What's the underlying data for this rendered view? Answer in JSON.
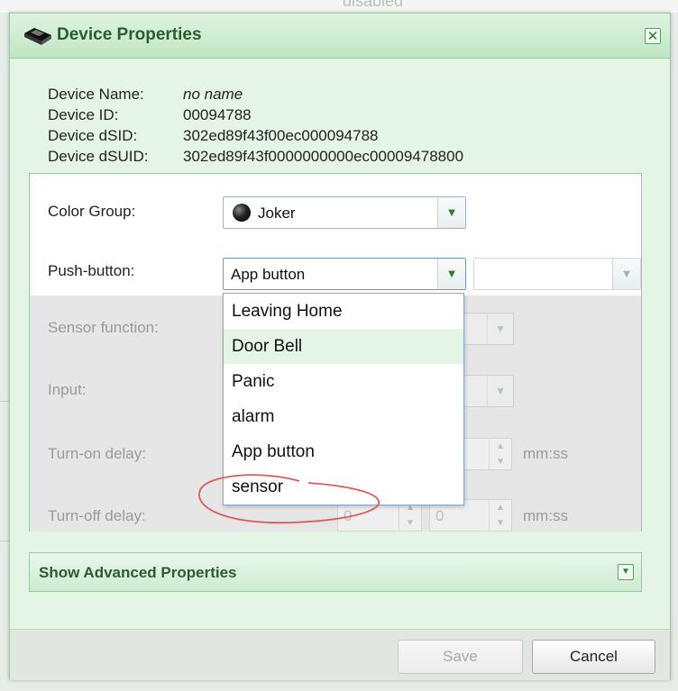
{
  "backdrop": {
    "ghost_text": "disabled"
  },
  "dialog": {
    "title": "Device Properties",
    "close_symbol": "✕"
  },
  "device_info": {
    "name_label": "Device Name:",
    "name_value": "no name",
    "id_label": "Device ID:",
    "id_value": "00094788",
    "dsid_label": "Device dSID:",
    "dsid_value": "302ed89f43f00ec000094788",
    "dsuid_label": "Device dSUID:",
    "dsuid_value": "302ed89f43f0000000000ec00009478800"
  },
  "form": {
    "color_group": {
      "label": "Color Group:",
      "value": "Joker"
    },
    "push_button": {
      "label": "Push-button:",
      "value": "App button",
      "secondary_value": ""
    },
    "sensor_function": {
      "label": "Sensor function:"
    },
    "input": {
      "label": "Input:"
    },
    "turn_on_delay": {
      "label": "Turn-on delay:",
      "unit": "mm:ss"
    },
    "turn_off_delay": {
      "label": "Turn-off delay:",
      "minutes": "0",
      "seconds": "0",
      "unit": "mm:ss"
    }
  },
  "dropdown": {
    "options": [
      "Leaving Home",
      "Door Bell",
      "Panic",
      "alarm",
      "App button",
      "sensor"
    ],
    "hovered": "Door Bell"
  },
  "advanced": {
    "label": "Show Advanced Properties"
  },
  "buttons": {
    "save": "Save",
    "cancel": "Cancel"
  },
  "colors": {
    "accent": "#2a5c30",
    "panel_bg": "#e4f5e6",
    "border": "#9dc7a2",
    "annotation": "#e05a5a"
  },
  "icons": {
    "title": "device-icon",
    "close": "close-icon",
    "arrow": "chevron-down-icon"
  }
}
